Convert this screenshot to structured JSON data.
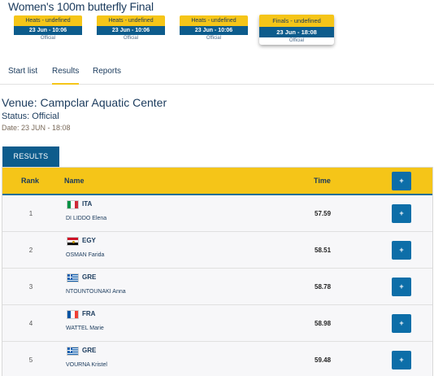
{
  "event": {
    "title": "Women's 100m butterfly Final"
  },
  "phases": [
    {
      "label": "Heats - undefined",
      "date": "23 Jun - 10:06",
      "status": "Official"
    },
    {
      "label": "Heats - undefined",
      "date": "23 Jun - 10:06",
      "status": "Official"
    },
    {
      "label": "Heats - undefined",
      "date": "23 Jun - 10:06",
      "status": "Official"
    },
    {
      "label": "Finals - undefined",
      "date": "23 Jun - 18:08",
      "status": "Official"
    }
  ],
  "tabs": {
    "start_list": "Start list",
    "results": "Results",
    "reports": "Reports"
  },
  "venue": {
    "title": "Venue: Campclar Aquatic Center",
    "status": "Status: Official",
    "date": "Date: 23 JUN - 18:08"
  },
  "results_tab": "RESULTS",
  "table": {
    "headers": {
      "rank": "Rank",
      "name": "Name",
      "time": "Time",
      "expand": "+"
    },
    "rows": [
      {
        "rank": "1",
        "country": "ITA",
        "flag": "italy-flag-icon",
        "name": "DI LIDDO Elena",
        "time": "57.59",
        "expand": "+"
      },
      {
        "rank": "2",
        "country": "EGY",
        "flag": "egypt-flag-icon",
        "name": "OSMAN Farida",
        "time": "58.51",
        "expand": "+"
      },
      {
        "rank": "3",
        "country": "GRE",
        "flag": "greece-flag-icon",
        "name": "NTOUNTOUNAKI Anna",
        "time": "58.78",
        "expand": "+"
      },
      {
        "rank": "4",
        "country": "FRA",
        "flag": "france-flag-icon",
        "name": "WATTEL Marie",
        "time": "58.98",
        "expand": "+"
      },
      {
        "rank": "5",
        "country": "GRE",
        "flag": "greece-flag-icon",
        "name": "VOURNA Kristel",
        "time": "59.48",
        "expand": "+"
      }
    ]
  },
  "colors": {
    "accent_yellow": "#f5c518",
    "primary_blue": "#0d5c8c",
    "button_blue": "#0d6ea8",
    "text_navy": "#1a3a5c"
  }
}
